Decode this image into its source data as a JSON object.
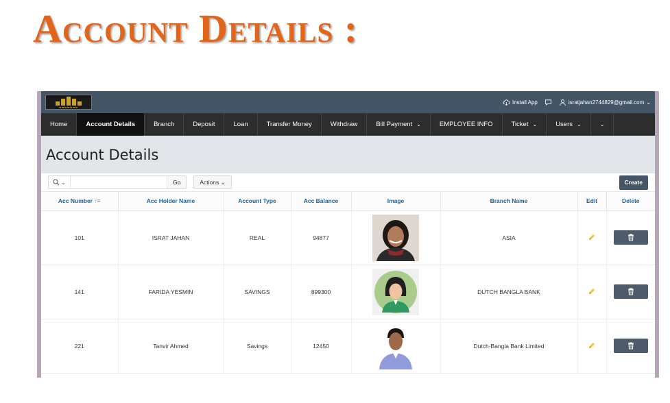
{
  "slide": {
    "title": "Account Details :"
  },
  "topbar": {
    "install_label": "Install App",
    "user_email": "isratjahan2744829@gmail.com"
  },
  "nav": {
    "items": [
      {
        "label": "Home",
        "active": false,
        "has_menu": false
      },
      {
        "label": "Account Details",
        "active": true,
        "has_menu": false
      },
      {
        "label": "Branch",
        "active": false,
        "has_menu": false
      },
      {
        "label": "Deposit",
        "active": false,
        "has_menu": false
      },
      {
        "label": "Loan",
        "active": false,
        "has_menu": false
      },
      {
        "label": "Transfer Money",
        "active": false,
        "has_menu": false
      },
      {
        "label": "Withdraw",
        "active": false,
        "has_menu": false
      },
      {
        "label": "Bill Payment",
        "active": false,
        "has_menu": true
      },
      {
        "label": "EMPLOYEE INFO",
        "active": false,
        "has_menu": false
      },
      {
        "label": "Ticket",
        "active": false,
        "has_menu": true
      },
      {
        "label": "Users",
        "active": false,
        "has_menu": true
      }
    ]
  },
  "page": {
    "title": "Account Details"
  },
  "toolbar": {
    "search_value": "",
    "go_label": "Go",
    "actions_label": "Actions",
    "create_label": "Create"
  },
  "table": {
    "columns": [
      "Acc Number",
      "Acc Holder Name",
      "Account Type",
      "Acc Balance",
      "Image",
      "Branch Name",
      "Edit",
      "Delete"
    ],
    "rows": [
      {
        "acc_number": "101",
        "holder": "ISRAT JAHAN",
        "type": "REAL",
        "balance": "94877",
        "image": "photo-woman",
        "branch": "ASIA"
      },
      {
        "acc_number": "141",
        "holder": "FARIDA YESMIN",
        "type": "SAVINGS",
        "balance": "899300",
        "image": "avatar-woman-illustration",
        "branch": "DUTCH BANGLA BANK"
      },
      {
        "acc_number": "221",
        "holder": "Tanvir Ahmed",
        "type": "Savings",
        "balance": "12450",
        "image": "photo-man",
        "branch": "Dutch-Bangla Bank Limited"
      }
    ]
  },
  "colors": {
    "title_orange": "#e0661c",
    "topbar": "#445566",
    "nav": "#2d2d2d",
    "header_link": "#1f5f96",
    "delete_button": "#4d5b6a"
  }
}
